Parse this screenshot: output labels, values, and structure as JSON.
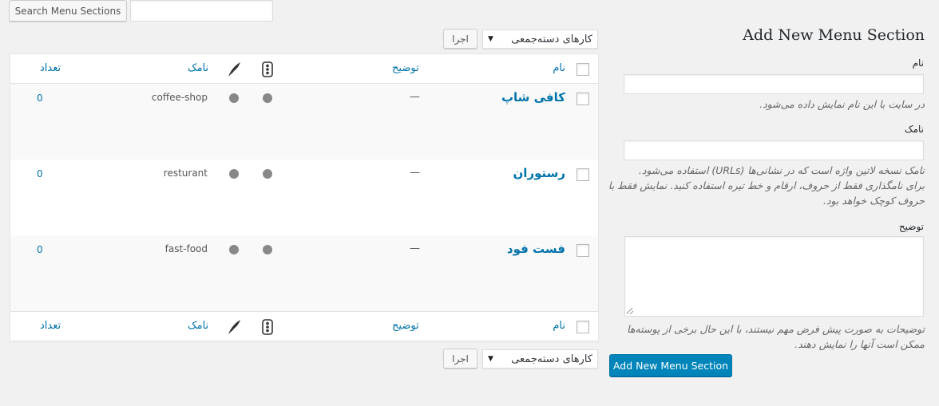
{
  "search": {
    "button_label": "Search Menu Sections",
    "input_value": ""
  },
  "bulk_actions": {
    "select_label": "کارهای دسته‌جمعی",
    "apply_label": "اجرا"
  },
  "table": {
    "columns": {
      "name": "نام",
      "description": "توضیح",
      "icon1": "traffic-light-icon",
      "icon2": "feather-icon",
      "slug": "نامک",
      "count": "تعداد"
    },
    "rows": [
      {
        "name": "کافی شاپ",
        "description": "—",
        "slug": "coffee-shop",
        "count": "0"
      },
      {
        "name": "رستوران",
        "description": "—",
        "slug": "resturant",
        "count": "0"
      },
      {
        "name": "فست فود",
        "description": "—",
        "slug": "fast-food",
        "count": "0"
      }
    ]
  },
  "form": {
    "title": "Add New Menu Section",
    "name_label": "نام",
    "name_value": "",
    "name_hint": "در سایت با این نام نمایش داده می‌شود.",
    "slug_label": "نامک",
    "slug_value": "",
    "slug_hint_1": "نامک نسخه لاتین واژه است که در نشانی‌ها (URLs) استفاده می‌شود.",
    "slug_hint_2": "برای نامگذاری فقط از حروف، ارقام و خط تیره استفاده کنید. نمایش فقط با",
    "slug_hint_3": "حروف کوچک خواهد بود.",
    "description_label": "توضیح",
    "description_value": "",
    "description_hint_1": "توضیحات به صورت پیش فرض مهم نیستند، با این حال برخی از پوسته‌ها",
    "description_hint_2": "ممکن است آنها را نمایش دهند.",
    "submit_label": "Add New Menu Section"
  },
  "colors": {
    "accent": "#0073aa",
    "primary_button": "#0085ba",
    "background": "#f1f1f1"
  }
}
